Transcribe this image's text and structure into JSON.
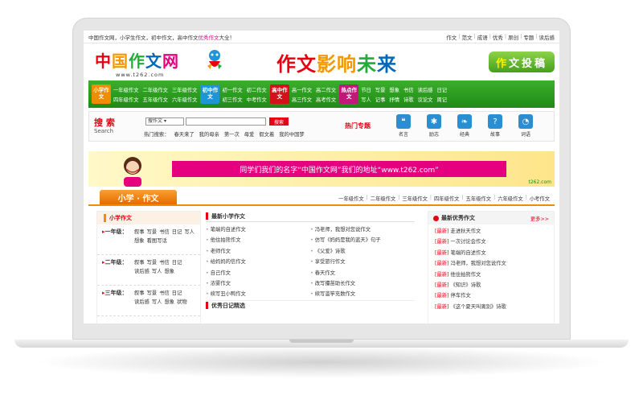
{
  "topbar": {
    "welcome_pre": "中国作文网，小学生作文，初中作文，高中作文",
    "welcome_hl": "优秀作文",
    "welcome_post": "大全！",
    "links": [
      "作文",
      "范文",
      "成语",
      "优秀",
      "原创",
      "专题",
      "读后感"
    ]
  },
  "header": {
    "logo_chars": [
      "中",
      "国",
      "作",
      "文",
      "网"
    ],
    "logo_url": "www.t262.com",
    "slogan_chars": [
      "作文",
      "影响",
      "未",
      "来"
    ],
    "submit_chars": [
      "作",
      "文",
      "投",
      "稿"
    ]
  },
  "nav": {
    "groups": [
      {
        "tag": "小学作文",
        "tag_color": "#f08c00",
        "links": [
          "一年级作文",
          "二年级作文",
          "三年级作文",
          "四年级作文",
          "五年级作文",
          "六年级作文"
        ]
      },
      {
        "tag": "初中作文",
        "tag_color": "#1e96d6",
        "links": [
          "初一作文",
          "初二作文",
          "初三作文",
          "中考作文"
        ]
      },
      {
        "tag": "高中作文",
        "tag_color": "#d6101a",
        "links": [
          "高一作文",
          "高二作文",
          "高三作文",
          "高考作文"
        ]
      },
      {
        "tag": "热点作文",
        "tag_color": "#c2187a",
        "links": [
          "节日",
          "写景",
          "想象",
          "书信",
          "读后感",
          "日记",
          "写人",
          "记事",
          "抒情",
          "诗歌",
          "议论文",
          "周记"
        ]
      }
    ]
  },
  "search": {
    "title": "搜 索",
    "title_en": "Search",
    "select_value": "搜作文",
    "button_label": "搜索",
    "hot_label": "热门搜索：",
    "hot_terms": [
      "春天来了",
      "我的母亲",
      "第一次",
      "母爱",
      "假文着",
      "我的中国梦"
    ],
    "hot_topic_title": "热门专题",
    "hot_icons": [
      {
        "label": "名言",
        "icon": "quote-icon"
      },
      {
        "label": "励志",
        "icon": "star-icon"
      },
      {
        "label": "经典",
        "icon": "book-icon"
      },
      {
        "label": "故事",
        "icon": "question-icon"
      },
      {
        "label": "词语",
        "icon": "chat-icon"
      }
    ]
  },
  "banner": {
    "text": "同学们我们的名字“中国作文网”我们的地址“www.t262.com”",
    "site": "t262.com"
  },
  "section": {
    "title": "小学 · 作文",
    "grade_links": [
      "一年级作文",
      "二年级作文",
      "三年级作文",
      "四年级作文",
      "五年级作文",
      "六年级作文",
      "小考作文"
    ]
  },
  "left": {
    "title": "小学作文",
    "grades": [
      {
        "label": "一年级：",
        "types": [
          "叙事",
          "写景",
          "书信",
          "日记",
          "写人",
          "想象",
          "看图写话"
        ]
      },
      {
        "label": "二年级：",
        "types": [
          "叙事",
          "写景",
          "书信",
          "日记",
          "读后感",
          "写人",
          "想象"
        ]
      },
      {
        "label": "三年级：",
        "types": [
          "叙事",
          "写景",
          "书信",
          "日记",
          "读后感",
          "写人",
          "想象",
          "状物"
        ]
      }
    ]
  },
  "mid": {
    "title": "最新小学作文",
    "items": [
      "笔端的自述作文",
      "冯老师，我想对您说作文",
      "他住拍熊作文",
      "仿写《妈妈是我的蓝天》句子",
      "老师作文",
      "《父爱》诗歌",
      "给妈妈的信作文",
      "享受旅行作文",
      "自己作文",
      "春天作文",
      "浓雾作文",
      "改写攥苗助长作文",
      "续写丑小鸭作文",
      "续写滥竽充数作文"
    ],
    "title2": "优秀日记精选"
  },
  "right": {
    "title": "最新优秀作文",
    "more": "更多>>",
    "tag": "[最新]",
    "items": [
      "走进秋天作文",
      "一次讨论会作文",
      "笔端的自述作文",
      "冯老师，我想对您说作文",
      "他住拍熊作文",
      "《知识》诗歌",
      "停车作文",
      "《这个夏天叫离别》诗歌"
    ]
  }
}
